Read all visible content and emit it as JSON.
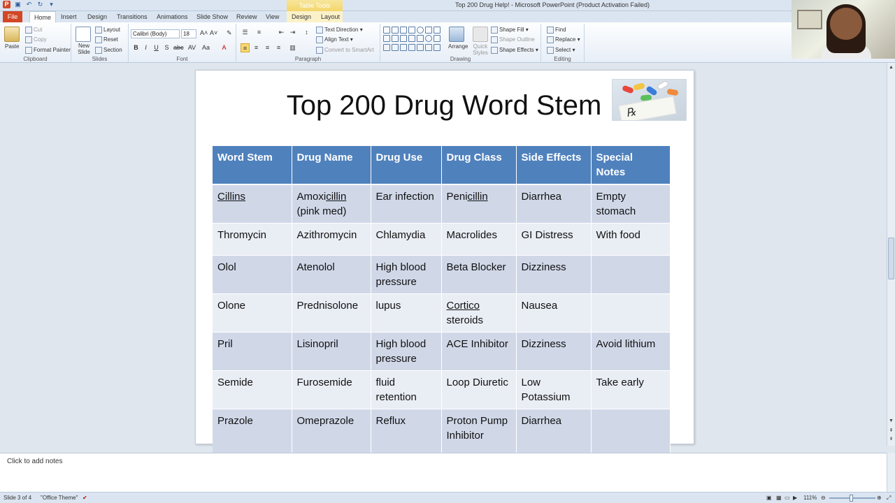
{
  "window": {
    "title": "Top 200 Drug Help!  -  Microsoft PowerPoint (Product Activation Failed)",
    "contextual_tab": "Table Tools"
  },
  "tabs": [
    {
      "label": "File"
    },
    {
      "label": "Home"
    },
    {
      "label": "Insert"
    },
    {
      "label": "Design"
    },
    {
      "label": "Transitions"
    },
    {
      "label": "Animations"
    },
    {
      "label": "Slide Show"
    },
    {
      "label": "Review"
    },
    {
      "label": "View"
    },
    {
      "label": "Design"
    },
    {
      "label": "Layout"
    }
  ],
  "ribbon": {
    "clipboard": {
      "paste": "Paste",
      "cut": "Cut",
      "copy": "Copy",
      "format_painter": "Format Painter",
      "label": "Clipboard"
    },
    "slides": {
      "new_slide": "New Slide",
      "layout": "Layout",
      "reset": "Reset",
      "section": "Section",
      "label": "Slides"
    },
    "font": {
      "family": "Calibri (Body)",
      "size": "18",
      "label": "Font"
    },
    "paragraph": {
      "text_direction": "Text Direction",
      "align_text": "Align Text",
      "smartart": "Convert to SmartArt",
      "label": "Paragraph"
    },
    "drawing": {
      "arrange": "Arrange",
      "quick_styles": "Quick Styles",
      "shape_fill": "Shape Fill",
      "shape_outline": "Shape Outline",
      "shape_effects": "Shape Effects",
      "label": "Drawing"
    },
    "editing": {
      "find": "Find",
      "replace": "Replace",
      "select": "Select",
      "label": "Editing"
    }
  },
  "slide": {
    "title": "Top 200 Drug Word Stem",
    "table": {
      "headers": [
        "Word Stem",
        "Drug Name",
        "Drug Use",
        "Drug Class",
        "Side Effects",
        "Special Notes"
      ],
      "rows": [
        {
          "stem": "Cillins",
          "name_prefix": "Amoxi",
          "name_suffix": "cillin",
          "name_note": "(pink med)",
          "use": "Ear infection",
          "class_prefix": "Peni",
          "class_suffix": "cillin",
          "side": "Diarrhea",
          "notes": "Empty stomach"
        },
        {
          "stem": "Thromycin",
          "name": "Azithromycin",
          "use": "Chlamydia",
          "class": "Macrolides",
          "side": "GI Distress",
          "notes": "With food"
        },
        {
          "stem": "Olol",
          "name": "Atenolol",
          "use": "High blood pressure",
          "class": "Beta Blocker",
          "side": "Dizziness",
          "notes": ""
        },
        {
          "stem": "Olone",
          "name": "Prednisolone",
          "use": "lupus",
          "class_prefix": "Cortico",
          "class_suffix": "steroids",
          "side": "Nausea",
          "notes": ""
        },
        {
          "stem": "Pril",
          "name": "Lisinopril",
          "use": "High blood pressure",
          "class": "ACE Inhibitor",
          "side": "Dizziness",
          "notes": "Avoid lithium"
        },
        {
          "stem": "Semide",
          "name": "Furosemide",
          "use": "fluid retention",
          "class": "Loop Diuretic",
          "side": "Low Potassium",
          "notes": "Take early"
        },
        {
          "stem": "Prazole",
          "name": "Omeprazole",
          "use": "Reflux",
          "class": "Proton Pump Inhibitor",
          "side": "Diarrhea",
          "notes": ""
        }
      ]
    }
  },
  "notes_placeholder": "Click to add notes",
  "status": {
    "slide_count": "Slide 3 of 4",
    "theme": "\"Office Theme\"",
    "zoom": "111%"
  }
}
